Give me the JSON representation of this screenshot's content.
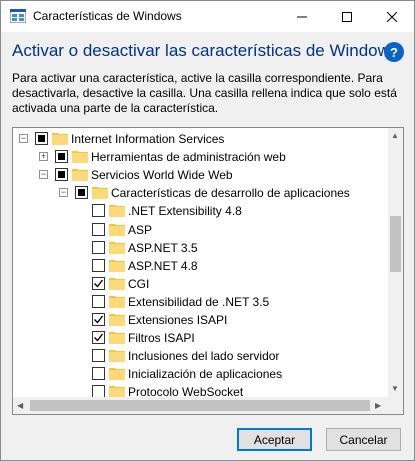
{
  "window": {
    "title": "Características de Windows"
  },
  "header": {
    "heading": "Activar o desactivar las características de Windows",
    "help_symbol": "?",
    "description": "Para activar una característica, active la casilla correspondiente. Para desactivarla, desactive la casilla. Una casilla rellena indica que solo está activada una parte de la característica."
  },
  "tree": {
    "items": [
      {
        "label": "Internet Information Services",
        "state": "partial",
        "expander": "−",
        "depth": 0
      },
      {
        "label": "Herramientas de administración web",
        "state": "partial",
        "expander": "+",
        "depth": 1
      },
      {
        "label": "Servicios World Wide Web",
        "state": "partial",
        "expander": "−",
        "depth": 1
      },
      {
        "label": "Características de desarrollo de aplicaciones",
        "state": "partial",
        "expander": "−",
        "depth": 2
      },
      {
        "label": ".NET Extensibility 4.8",
        "state": "unchecked",
        "depth": 3
      },
      {
        "label": "ASP",
        "state": "unchecked",
        "depth": 3
      },
      {
        "label": "ASP.NET 3.5",
        "state": "unchecked",
        "depth": 3
      },
      {
        "label": "ASP.NET 4.8",
        "state": "unchecked",
        "depth": 3
      },
      {
        "label": "CGI",
        "state": "checked",
        "depth": 3
      },
      {
        "label": "Extensibilidad de .NET 3.5",
        "state": "unchecked",
        "depth": 3
      },
      {
        "label": "Extensiones ISAPI",
        "state": "checked",
        "depth": 3
      },
      {
        "label": "Filtros ISAPI",
        "state": "checked",
        "depth": 3
      },
      {
        "label": "Inclusiones del lado servidor",
        "state": "unchecked",
        "depth": 3
      },
      {
        "label": "Inicialización de aplicaciones",
        "state": "unchecked",
        "depth": 3
      },
      {
        "label": "Protocolo WebSocket",
        "state": "unchecked",
        "depth": 3
      }
    ]
  },
  "buttons": {
    "accept": "Aceptar",
    "cancel": "Cancelar"
  },
  "colors": {
    "heading": "#00328c",
    "folder": "#f5c542",
    "accent": "#0078d7"
  }
}
